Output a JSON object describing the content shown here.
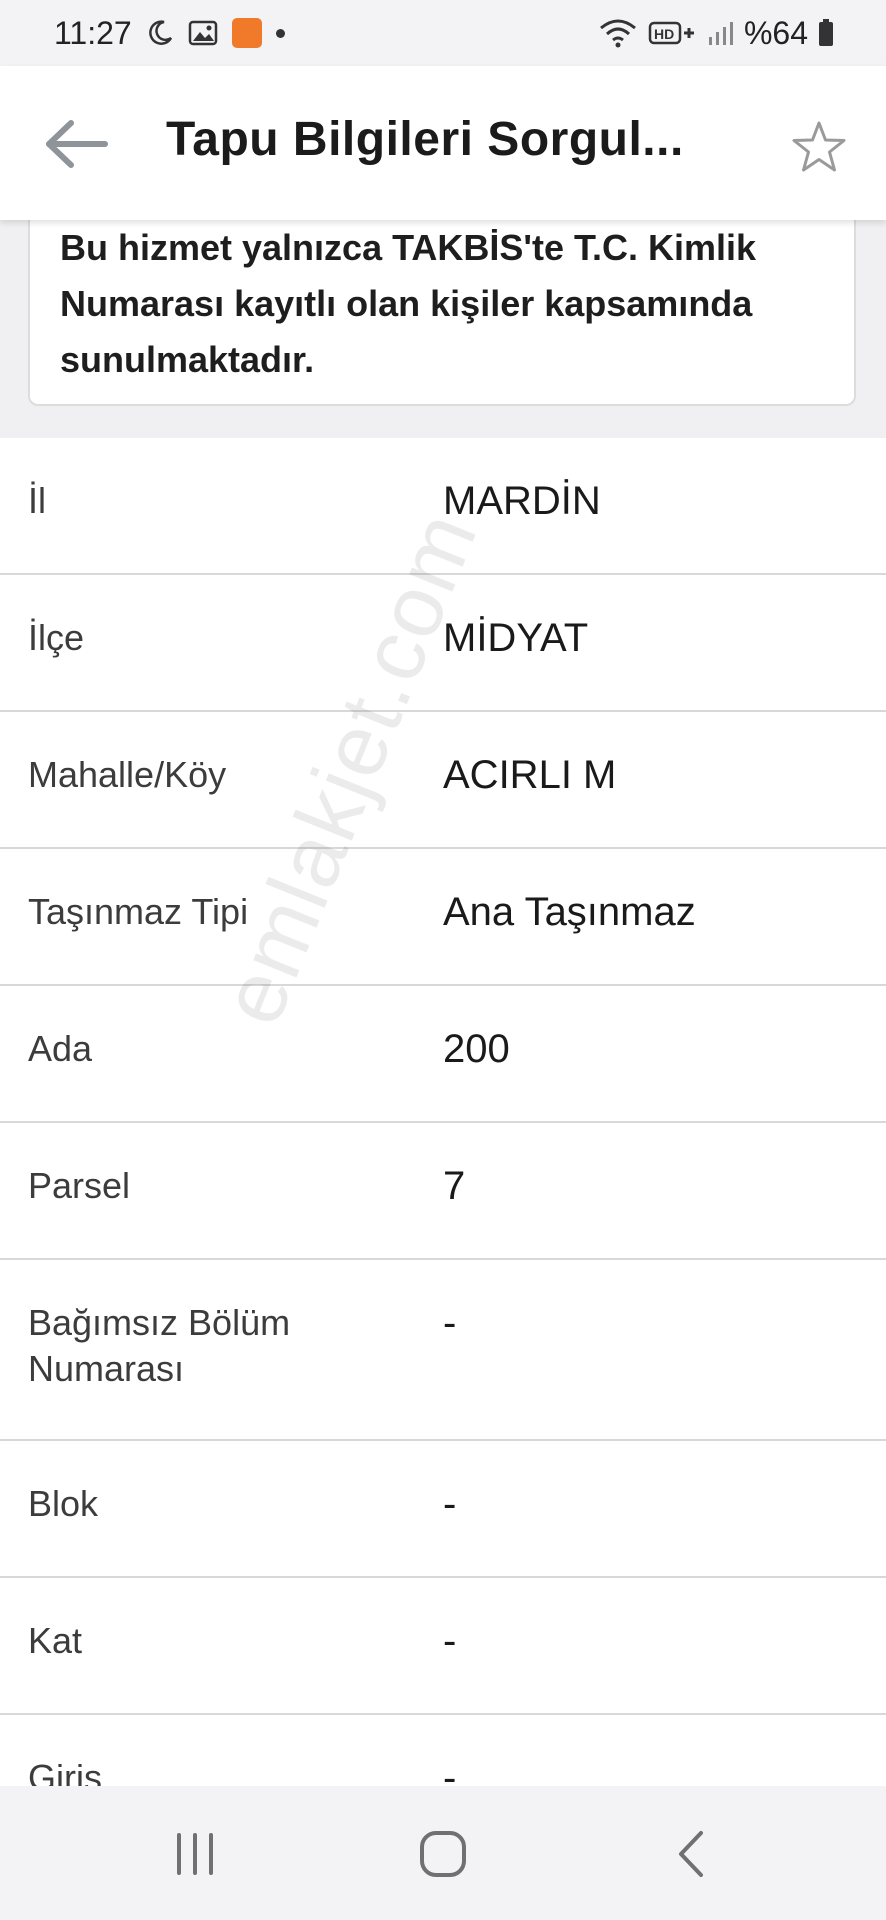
{
  "status_bar": {
    "time": "11:27",
    "left_icons": [
      "moon-icon",
      "gallery-icon",
      "app-notification-icon",
      "dot-icon"
    ],
    "right_icons": [
      "wifi-icon",
      "hd-plus-icon",
      "signal-icon"
    ],
    "battery_text": "%64"
  },
  "app_bar": {
    "title": "Tapu Bilgileri Sorgul...",
    "back_icon": "back-arrow-icon",
    "favorite_icon": "star-outline-icon"
  },
  "notice": {
    "text": "Bu hizmet yalnızca TAKBİS'te T.C. Kimlik Numarası kayıtlı olan kişiler kapsamında sunulmaktadır."
  },
  "rows": [
    {
      "label": "İl",
      "value": "MARDİN"
    },
    {
      "label": "İlçe",
      "value": "MİDYAT"
    },
    {
      "label": "Mahalle/Köy",
      "value": "ACIRLI M"
    },
    {
      "label": "Taşınmaz Tipi",
      "value": "Ana Taşınmaz"
    },
    {
      "label": "Ada",
      "value": "200"
    },
    {
      "label": "Parsel",
      "value": "7"
    },
    {
      "label": "Bağımsız Bölüm Numarası",
      "value": "-"
    },
    {
      "label": "Blok",
      "value": "-"
    },
    {
      "label": "Kat",
      "value": "-"
    },
    {
      "label": "Giriş",
      "value": "-"
    }
  ],
  "watermark": "emlakjet.com",
  "nav_bar": {
    "icons": [
      "recent-apps-icon",
      "home-icon",
      "back-icon"
    ]
  },
  "colors": {
    "status_bg": "#f3f3f5",
    "top_area_bg": "#f0f0f2",
    "divider": "#d8d8d8",
    "icon_gray": "#9a9a9a"
  }
}
